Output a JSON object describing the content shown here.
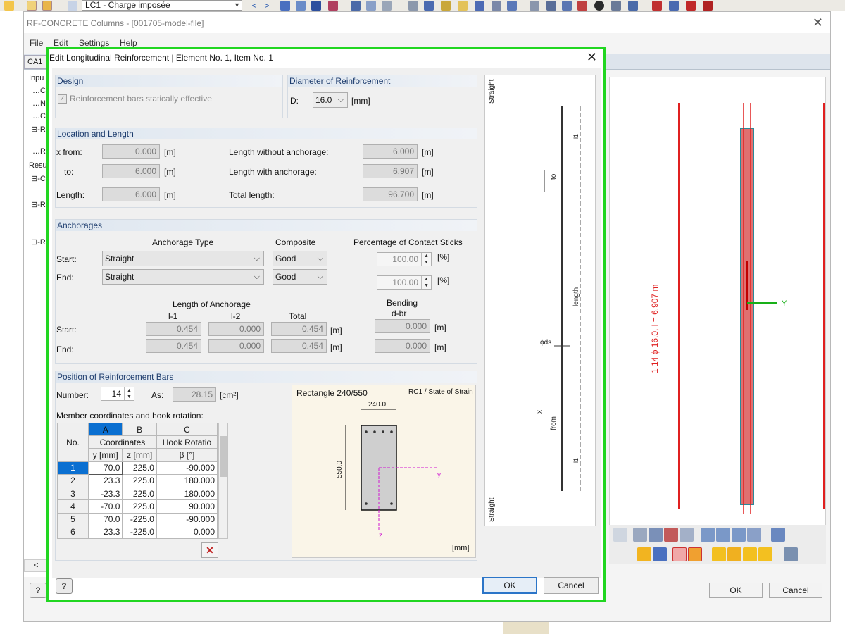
{
  "app_toolbar": {
    "load_case": "LC1 - Charge imposée"
  },
  "bg_window": {
    "title": "RF-CONCRETE Columns - [001705-model-file]",
    "menu": [
      "File",
      "Edit",
      "Settings",
      "Help"
    ],
    "tab": "CA1",
    "tree": [
      {
        "label": "Inpu"
      },
      {
        "label": "…C"
      },
      {
        "label": "…N"
      },
      {
        "label": "…C"
      },
      {
        "label": "⊟-R"
      },
      {
        "label": "…R"
      },
      {
        "label": "Resu"
      },
      {
        "label": "⊟-C"
      },
      {
        "label": "⊟-R"
      },
      {
        "label": "⊟-R"
      }
    ],
    "graphic_label": "1  14 ϕ 16.0, l = 6.907 m",
    "axis_y": "Y",
    "ok": "OK",
    "cancel": "Cancel"
  },
  "dialog": {
    "title": "Edit Longitudinal Reinforcement | Element No. 1, Item No. 1",
    "design": {
      "heading": "Design",
      "checkbox_label": "Reinforcement bars statically effective",
      "checked": true
    },
    "diameter": {
      "heading": "Diameter of Reinforcement",
      "label": "D:",
      "value": "16.0",
      "unit": "[mm]"
    },
    "location": {
      "heading": "Location and Length",
      "x_from_label": "x from:",
      "x_from": "0.000",
      "to_label": "to:",
      "to": "6.000",
      "length_label": "Length:",
      "length": "6.000",
      "len_without_label": "Length without anchorage:",
      "len_without": "6.000",
      "len_with_label": "Length with anchorage:",
      "len_with": "6.907",
      "total_label": "Total length:",
      "total": "96.700",
      "unit": "[m]"
    },
    "anchorages": {
      "heading": "Anchorages",
      "col_type": "Anchorage Type",
      "col_composite": "Composite",
      "col_percentage": "Percentage of Contact Sticks",
      "start_label": "Start:",
      "end_label": "End:",
      "start_type": "Straight",
      "end_type": "Straight",
      "start_comp": "Good",
      "end_comp": "Good",
      "start_pct": "100.00",
      "end_pct": "100.00",
      "pct_unit": "[%]",
      "len_heading": "Length of Anchorage",
      "col_l1": "l-1",
      "col_l2": "l-2",
      "col_total": "Total",
      "bending_heading": "Bending",
      "bending_sub": "d-br",
      "start_l1": "0.454",
      "start_l2": "0.000",
      "start_total": "0.454",
      "end_l1": "0.454",
      "end_l2": "0.000",
      "end_total": "0.454",
      "start_bend": "0.000",
      "end_bend": "0.000",
      "unit_m": "[m]"
    },
    "position": {
      "heading": "Position of Reinforcement Bars",
      "number_label": "Number:",
      "number": "14",
      "as_label": "As:",
      "as_value": "28.15",
      "as_unit": "[cm²]",
      "coords_label": "Member coordinates and hook rotation:",
      "table": {
        "col_letters": [
          "A",
          "B",
          "C"
        ],
        "no_header": "No.",
        "coord_header": "Coordinates",
        "hook_header": "Hook Rotatio",
        "sub_headers": [
          "y [mm]",
          "z [mm]",
          "β [°]"
        ],
        "rows": [
          {
            "no": "1",
            "y": "70.0",
            "z": "225.0",
            "beta": "-90.000"
          },
          {
            "no": "2",
            "y": "23.3",
            "z": "225.0",
            "beta": "180.000"
          },
          {
            "no": "3",
            "y": "-23.3",
            "z": "225.0",
            "beta": "180.000"
          },
          {
            "no": "4",
            "y": "-70.0",
            "z": "225.0",
            "beta": "90.000"
          },
          {
            "no": "5",
            "y": "70.0",
            "z": "-225.0",
            "beta": "-90.000"
          },
          {
            "no": "6",
            "y": "23.3",
            "z": "-225.0",
            "beta": "0.000"
          }
        ]
      },
      "section_title": "Rectangle 240/550",
      "section_state": "RC1 / State of Strain",
      "section_width": "240.0",
      "section_height": "550.0",
      "section_y": "y",
      "section_z": "z",
      "section_unit": "[mm]"
    },
    "bar_diagram": {
      "top_label": "Straight",
      "bottom_label": "Straight",
      "to_label": "to",
      "length_label": "length",
      "from_label": "from",
      "x_label": "x",
      "ds_label": "ϕds",
      "l1_label": "l1"
    },
    "ok": "OK",
    "cancel": "Cancel"
  },
  "colors": {
    "highlight_border": "#21d621",
    "group_heading": "#1e3d6e",
    "selection": "#0a6fd1",
    "rebar_red": "#e02020"
  }
}
